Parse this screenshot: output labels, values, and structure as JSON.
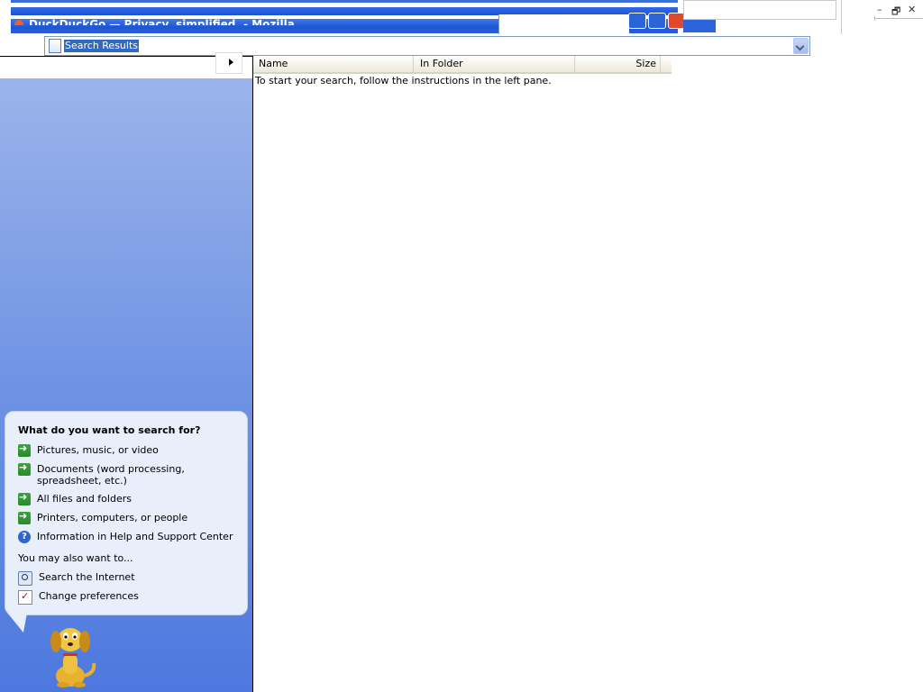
{
  "window": {
    "title": "DuckDuckGo — Privacy, simplified. - Mozilla",
    "controls": {
      "minimize": "–",
      "restore": "🗗",
      "close": "✕"
    }
  },
  "address_bar": {
    "value": "Search Results",
    "icon": "search-results-icon"
  },
  "companion": {
    "heading": "What do you want to search for?",
    "options": [
      {
        "label": "Pictures, music, or video",
        "icon": "green-arrow-icon"
      },
      {
        "label": "Documents (word processing, spreadsheet, etc.)",
        "icon": "green-arrow-icon"
      },
      {
        "label": "All files and folders",
        "icon": "green-arrow-icon"
      },
      {
        "label": "Printers, computers, or people",
        "icon": "green-arrow-icon"
      },
      {
        "label": "Information in Help and Support Center",
        "icon": "help-icon"
      }
    ],
    "also_heading": "You may also want to...",
    "also": [
      {
        "label": "Search the Internet",
        "icon": "search-internet-icon"
      },
      {
        "label": "Change preferences",
        "icon": "preferences-icon"
      }
    ],
    "character": "search-dog-icon"
  },
  "results": {
    "columns": [
      "Name",
      "In Folder",
      "Size"
    ],
    "empty_message": "To start your search, follow the instructions in the left pane."
  },
  "colors": {
    "left_pane_top": "#9bb4ea",
    "left_pane_bottom": "#4d78de",
    "bubble": "#e9eefb",
    "selection": "#316ac5"
  }
}
